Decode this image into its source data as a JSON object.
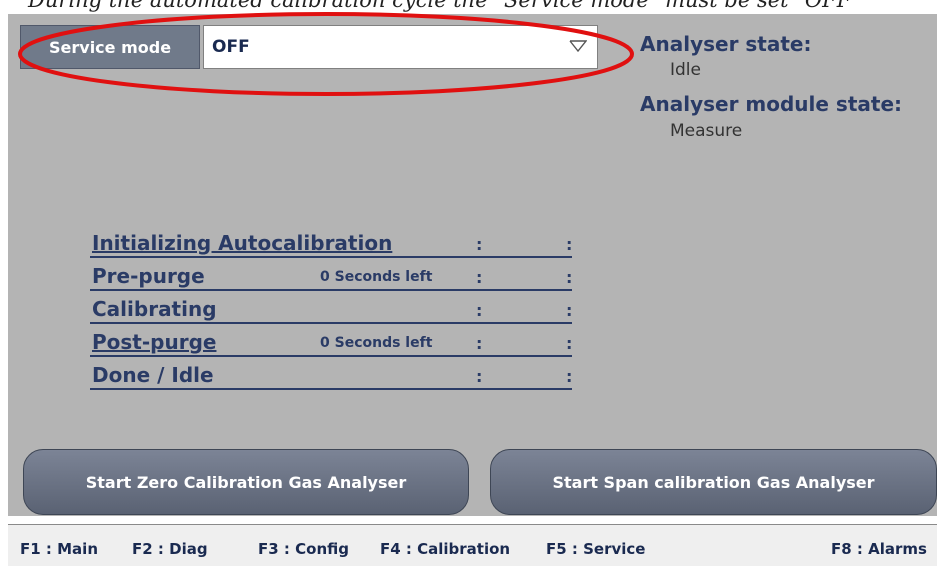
{
  "caption": "During the automated calibration cycle the \"Service mode\" must be set \"OFF\"",
  "service": {
    "label": "Service mode",
    "value": "OFF",
    "chevron_icon": "chevron-down-icon"
  },
  "status": {
    "analyser_state_title": "Analyser state:",
    "analyser_state_value": "Idle",
    "module_state_title": "Analyser module state:",
    "module_state_value": "Measure"
  },
  "steps": [
    {
      "label": "Initializing Autocalibration",
      "left": "",
      "c1": ":",
      "c2": ":"
    },
    {
      "label": "Pre-purge",
      "left": "0 Seconds left",
      "c1": ":",
      "c2": ":"
    },
    {
      "label": "Calibrating",
      "left": "",
      "c1": ":",
      "c2": ":"
    },
    {
      "label": "Post-purge",
      "left": "0 Seconds left",
      "c1": ":",
      "c2": ":"
    },
    {
      "label": "Done / Idle",
      "left": "",
      "c1": ":",
      "c2": ":"
    }
  ],
  "buttons": {
    "zero": "Start Zero Calibration Gas Analyser",
    "span": "Start Span calibration Gas Analyser"
  },
  "footer": {
    "f1": "F1 : Main",
    "f2": "F2 : Diag",
    "f3": "F3 : Config",
    "f4": "F4 : Calibration",
    "f5": "F5 : Service",
    "f8": "F8 : Alarms"
  },
  "colors": {
    "panel": "#b4b4b4",
    "accent_text": "#2a3b66",
    "highlight": "#e01010",
    "button": "#6a7283"
  }
}
